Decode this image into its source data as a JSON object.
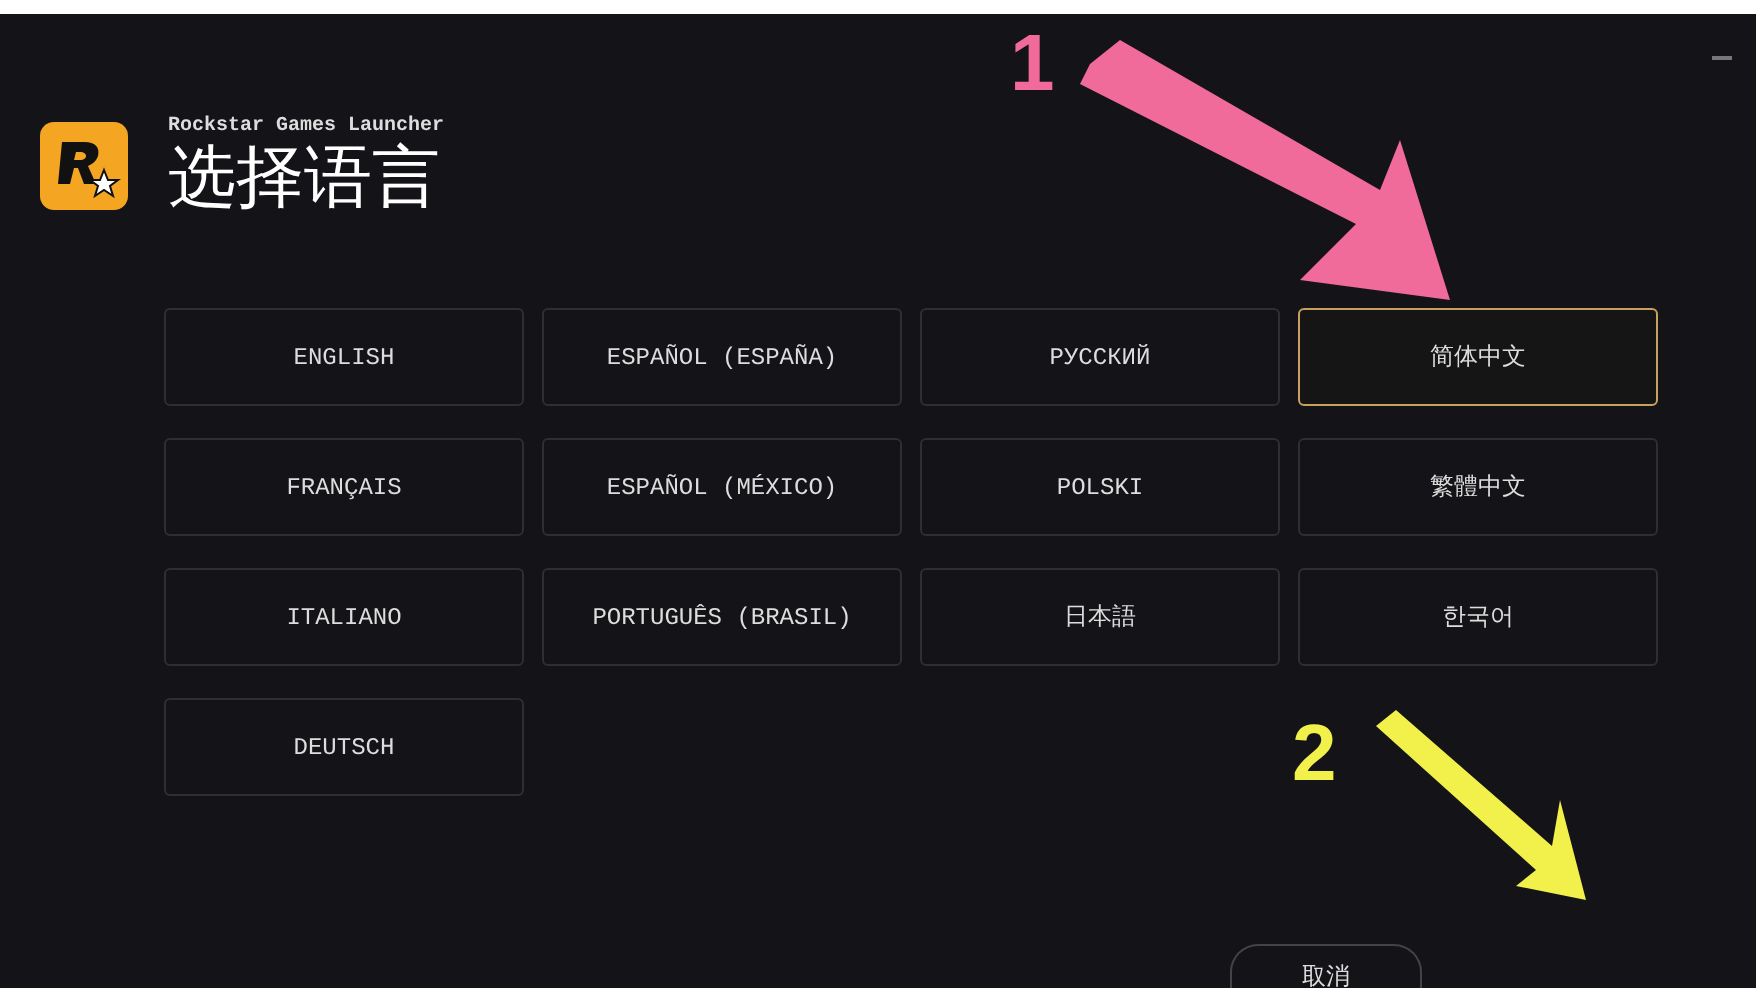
{
  "app": {
    "name": "Rockstar Games Launcher",
    "title": "选择语言"
  },
  "languages": [
    {
      "label": "ENGLISH",
      "selected": false
    },
    {
      "label": "ESPAÑOL (ESPAÑA)",
      "selected": false
    },
    {
      "label": "РУССКИЙ",
      "selected": false
    },
    {
      "label": "简体中文",
      "selected": true
    },
    {
      "label": "FRANÇAIS",
      "selected": false
    },
    {
      "label": "ESPAÑOL (MÉXICO)",
      "selected": false
    },
    {
      "label": "POLSKI",
      "selected": false
    },
    {
      "label": "繁體中文",
      "selected": false
    },
    {
      "label": "ITALIANO",
      "selected": false
    },
    {
      "label": "PORTUGUÊS (BRASIL)",
      "selected": false
    },
    {
      "label": "日本語",
      "selected": false
    },
    {
      "label": "한국어",
      "selected": false
    },
    {
      "label": "DEUTSCH",
      "selected": false
    }
  ],
  "cancel_button": "取消",
  "annotations": [
    {
      "label": "1",
      "color": "#f06a9a"
    },
    {
      "label": "2",
      "color": "#f2f04a"
    }
  ]
}
